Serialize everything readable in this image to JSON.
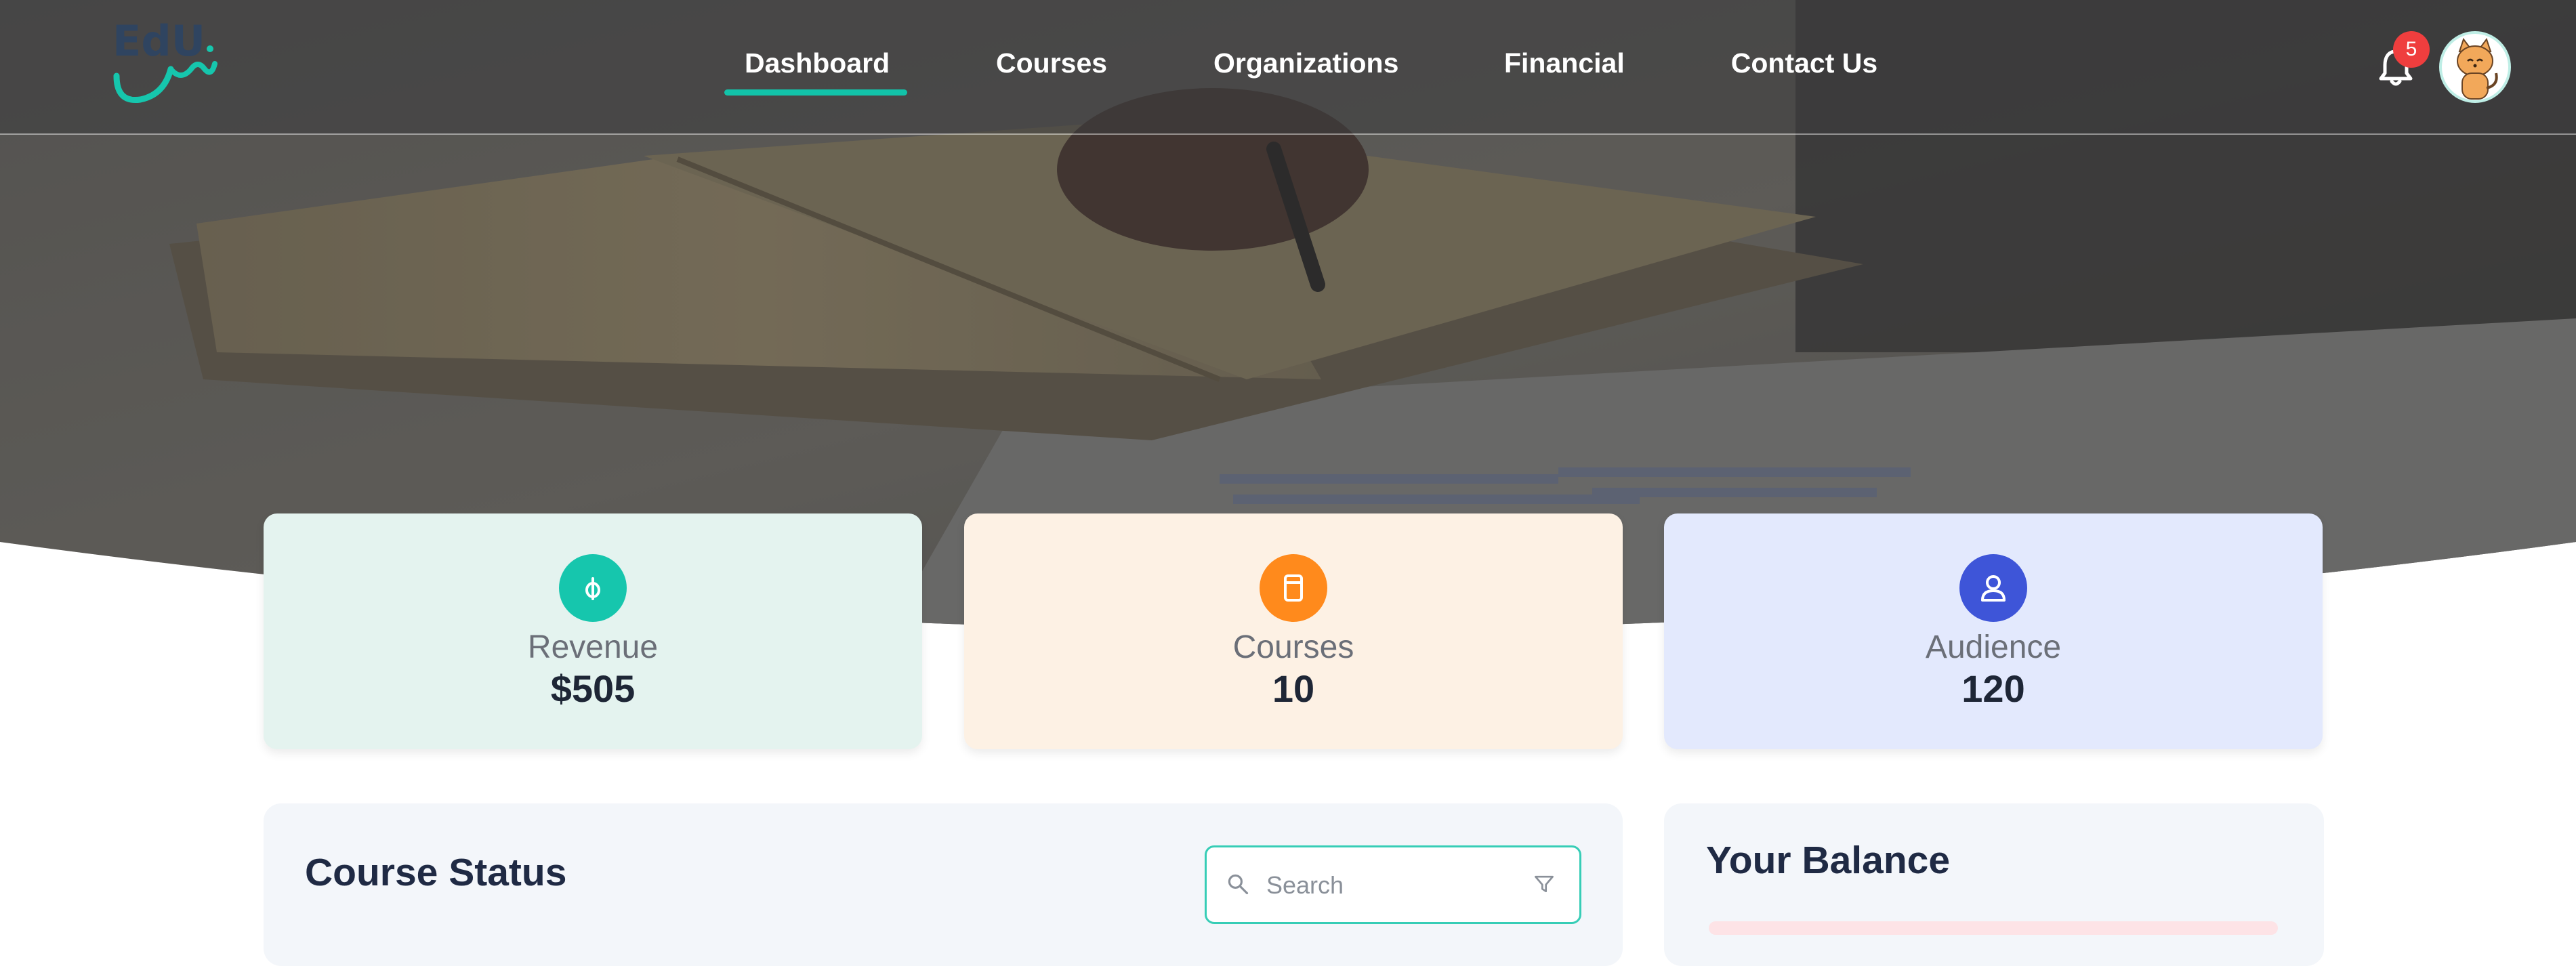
{
  "header": {
    "logo_text": "EdU نس",
    "nav": [
      {
        "label": "Dashboard",
        "active": true
      },
      {
        "label": "Courses",
        "active": false
      },
      {
        "label": "Organizations",
        "active": false
      },
      {
        "label": "Financial",
        "active": false
      },
      {
        "label": "Contact Us",
        "active": false
      }
    ],
    "notifications": {
      "icon": "bell-icon",
      "count": "5"
    },
    "avatar_icon": "cat-avatar"
  },
  "stats": [
    {
      "label": "Revenue",
      "value": "$505",
      "icon": "coin-icon",
      "bg": "#e4f3ef",
      "icon_bg": "#16c6ad"
    },
    {
      "label": "Courses",
      "value": "10",
      "icon": "book-icon",
      "bg": "#fdf1e4",
      "icon_bg": "#ff8a1c"
    },
    {
      "label": "Audience",
      "value": "120",
      "icon": "user-icon",
      "bg": "#e3e9fd",
      "icon_bg": "#3e55d8"
    }
  ],
  "course_status": {
    "title": "Course Status",
    "search_placeholder": "Search",
    "search_icon": "search-icon",
    "filter_icon": "filter-icon"
  },
  "balance": {
    "title": "Your Balance"
  },
  "colors": {
    "accent": "#12c3a9",
    "badge": "#ef3e3e",
    "title": "#1f2a44"
  }
}
